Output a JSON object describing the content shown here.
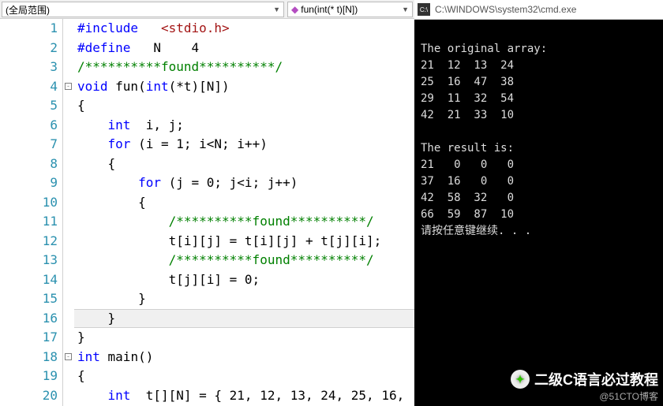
{
  "toolbar": {
    "scope": "(全局范围)",
    "symbol": "fun(int(* t)[N])"
  },
  "lines": [
    {
      "n": 1,
      "fold": "",
      "html": "<span class='kw-inc'>#include</span>   <span class='str'>&lt;stdio.h&gt;</span>"
    },
    {
      "n": 2,
      "fold": "",
      "html": "<span class='kw-inc'>#define</span>   N    4"
    },
    {
      "n": 3,
      "fold": "",
      "html": "<span class='comment'>/**********found**********/</span>"
    },
    {
      "n": 4,
      "fold": "box",
      "html": "<span class='kw-blue'>void</span> fun(<span class='kw-blue'>int</span>(*t)[N])"
    },
    {
      "n": 5,
      "fold": "",
      "html": "{"
    },
    {
      "n": 6,
      "fold": "",
      "html": "    <span class='kw-blue'>int</span>  i, j;"
    },
    {
      "n": 7,
      "fold": "",
      "html": "    <span class='kw-blue'>for</span> (i = 1; i&lt;N; i++)"
    },
    {
      "n": 8,
      "fold": "",
      "html": "    {"
    },
    {
      "n": 9,
      "fold": "",
      "html": "        <span class='kw-blue'>for</span> (j = 0; j&lt;i; j++)"
    },
    {
      "n": 10,
      "fold": "",
      "html": "        {"
    },
    {
      "n": 11,
      "fold": "",
      "html": "            <span class='comment'>/**********found**********/</span>"
    },
    {
      "n": 12,
      "fold": "",
      "html": "            t[i][j] = t[i][j] + t[j][i];"
    },
    {
      "n": 13,
      "fold": "",
      "html": "            <span class='comment'>/**********found**********/</span>"
    },
    {
      "n": 14,
      "fold": "",
      "html": "            t[j][i] = 0;"
    },
    {
      "n": 15,
      "fold": "",
      "html": "        }"
    },
    {
      "n": 16,
      "fold": "",
      "html": "    }",
      "highlight": true
    },
    {
      "n": 17,
      "fold": "",
      "html": "}"
    },
    {
      "n": 18,
      "fold": "box",
      "html": "<span class='kw-blue'>int</span> main()"
    },
    {
      "n": 19,
      "fold": "",
      "html": "{"
    },
    {
      "n": 20,
      "fold": "",
      "html": "    <span class='kw-blue'>int</span>  t[][N] = { 21, 12, 13, 24, 25, 16,"
    }
  ],
  "console": {
    "title": "C:\\WINDOWS\\system32\\cmd.exe",
    "text": "\nThe original array:\n21  12  13  24\n25  16  47  38\n29  11  32  54\n42  21  33  10\n\nThe result is:\n21   0   0   0\n37  16   0   0\n42  58  32   0\n66  59  87  10\n请按任意键继续. . ."
  },
  "footer": {
    "title": "二级C语言必过教程",
    "sub": "@51CTO博客"
  }
}
